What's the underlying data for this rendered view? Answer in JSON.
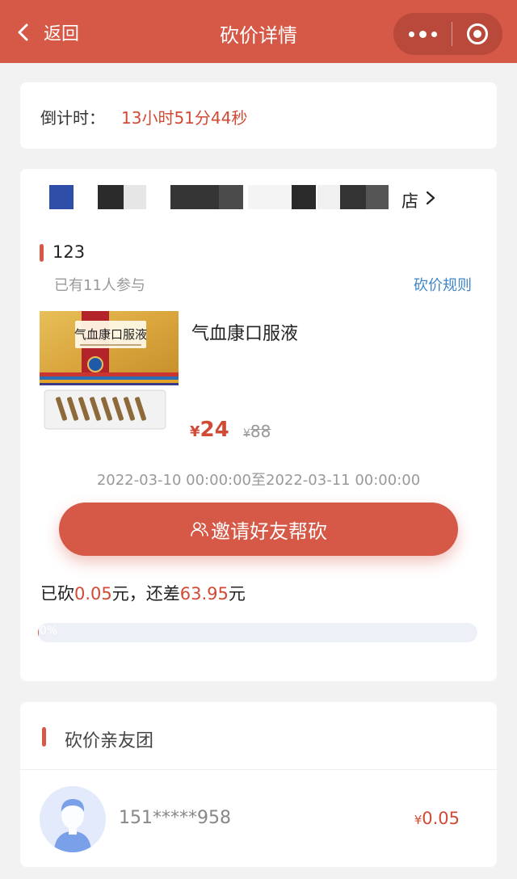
{
  "nav": {
    "back_label": "返回",
    "title": "砍价详情",
    "bg_color": "#d65846"
  },
  "countdown": {
    "label": "倒计时：",
    "value": "13小时51分44秒"
  },
  "store": {
    "name_suffix": "店"
  },
  "activity": {
    "name": "123",
    "participants": "已有11人参与",
    "rules_link": "砍价规则"
  },
  "product": {
    "name": "气血康口服液",
    "image_text": "气血康口服液",
    "price_symbol": "¥",
    "price": "24",
    "original_price": "88",
    "period": "2022-03-10 00:00:00至2022-03-11 00:00:00"
  },
  "invite_button": {
    "label": "邀请好友帮砍",
    "icon": "users-icon"
  },
  "progress": {
    "prefix": "已砍",
    "cut_amount": "0.05",
    "middle": "元，还差",
    "remaining": "63.95",
    "suffix": "元",
    "percent_label": "0%",
    "fraction": 0.0008
  },
  "friends": {
    "title": "砍价亲友团",
    "items": [
      {
        "phone": "151*****958",
        "symbol": "¥",
        "amount": "0.05"
      }
    ]
  }
}
